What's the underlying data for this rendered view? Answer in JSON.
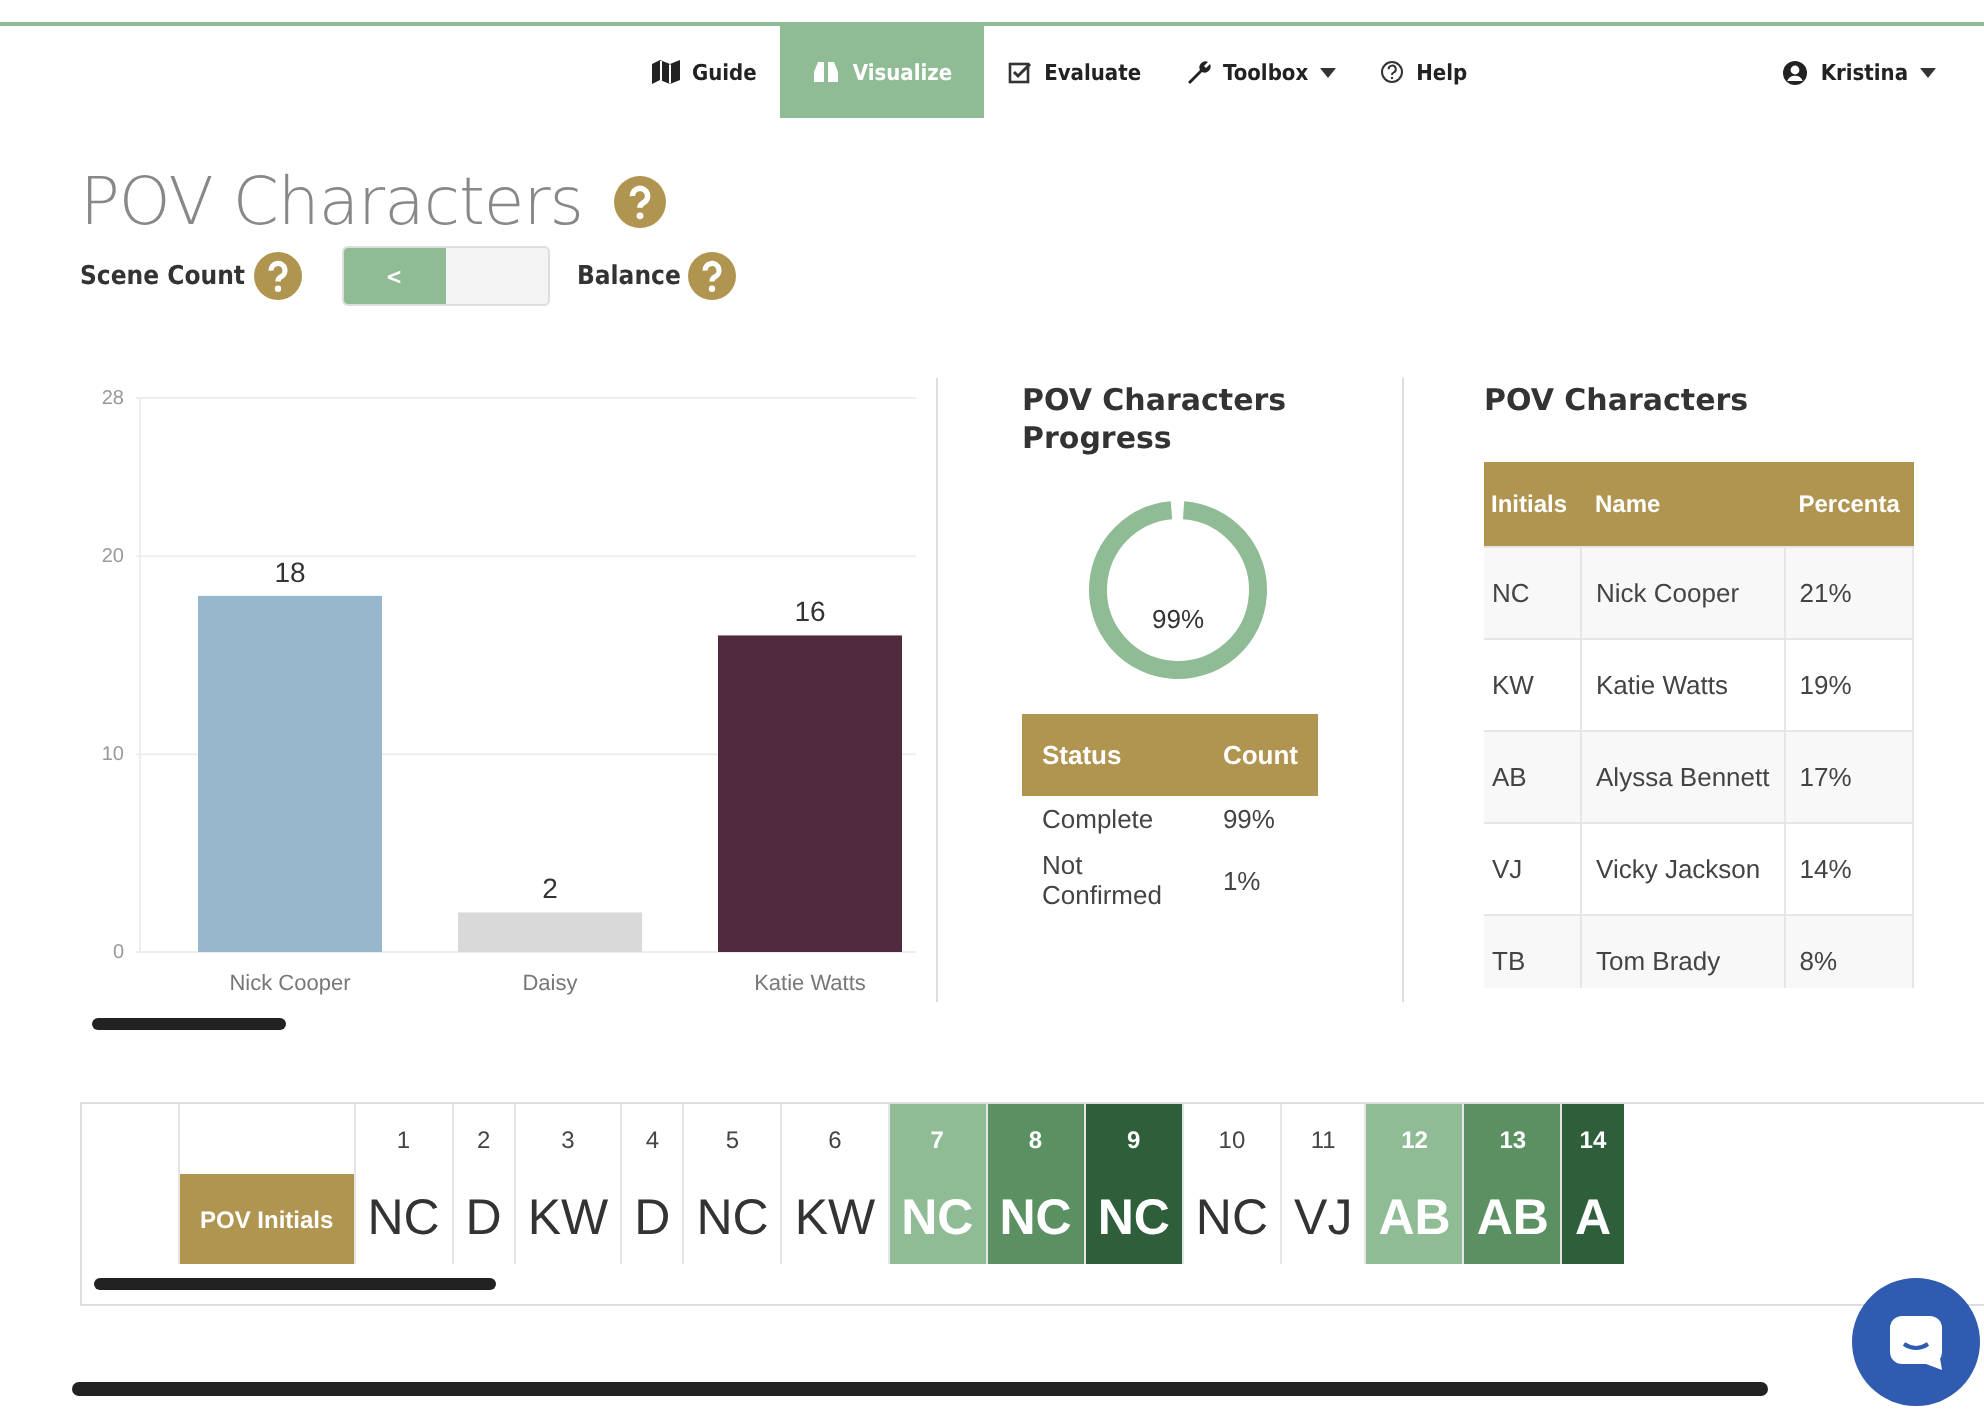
{
  "nav": {
    "items": [
      {
        "label": "Guide",
        "selected": false,
        "dropdown": false
      },
      {
        "label": "Visualize",
        "selected": true,
        "dropdown": false
      },
      {
        "label": "Evaluate",
        "selected": false,
        "dropdown": false
      },
      {
        "label": "Toolbox",
        "selected": false,
        "dropdown": true
      },
      {
        "label": "Help",
        "selected": false,
        "dropdown": false
      }
    ],
    "user": {
      "label": "Kristina",
      "dropdown": true
    }
  },
  "header": {
    "title": "POV Characters",
    "left_label": "Scene Count",
    "toggle": {
      "label": "<",
      "on": true
    },
    "right_label": "Balance"
  },
  "bar_chart": {
    "chart_data": {
      "type": "bar",
      "categories": [
        "Nick Cooper",
        "Daisy",
        "Katie Watts"
      ],
      "values": [
        18,
        2,
        16
      ],
      "colors": [
        "#97b8cc",
        "#d9d9d9",
        "#502b40"
      ],
      "yticks": [
        0,
        10,
        20,
        28
      ],
      "ylim": [
        0,
        28
      ],
      "data_labels": true
    }
  },
  "progress": {
    "title": "POV Characters Progress",
    "label": "99%",
    "columns": [
      "Status",
      "Count"
    ],
    "rows": [
      [
        "Complete",
        "99%"
      ],
      [
        "Not Confirmed",
        "1%"
      ]
    ]
  },
  "characters": {
    "title": "POV Characters",
    "columns": [
      "Initials",
      "Name",
      "Percenta"
    ],
    "rows": [
      [
        "NC",
        "Nick Cooper",
        "21%"
      ],
      [
        "KW",
        "Katie Watts",
        "19%"
      ],
      [
        "AB",
        "Alyssa Bennett",
        "17%"
      ],
      [
        "VJ",
        "Vicky Jackson",
        "14%"
      ],
      [
        "TB",
        "Tom Brady",
        "8%"
      ]
    ]
  },
  "timeline": {
    "row_label": "POV Initials",
    "scenes": [
      {
        "number": "1",
        "initials": "NC"
      },
      {
        "number": "2",
        "initials": "D"
      },
      {
        "number": "3",
        "initials": "KW"
      },
      {
        "number": "4",
        "initials": "D"
      },
      {
        "number": "5",
        "initials": "NC"
      },
      {
        "number": "6",
        "initials": "KW"
      },
      {
        "number": "7",
        "initials": "NC",
        "color": "#8fbc94"
      },
      {
        "number": "8",
        "initials": "NC",
        "color": "#5b9162"
      },
      {
        "number": "9",
        "initials": "NC",
        "color": "#2f5e3a"
      },
      {
        "number": "10",
        "initials": "NC"
      },
      {
        "number": "11",
        "initials": "VJ"
      },
      {
        "number": "12",
        "initials": "AB",
        "color": "#8fbc94"
      },
      {
        "number": "13",
        "initials": "AB",
        "color": "#5b9162"
      },
      {
        "number": "14",
        "initials": "A",
        "color": "#2f5e3a"
      }
    ]
  }
}
